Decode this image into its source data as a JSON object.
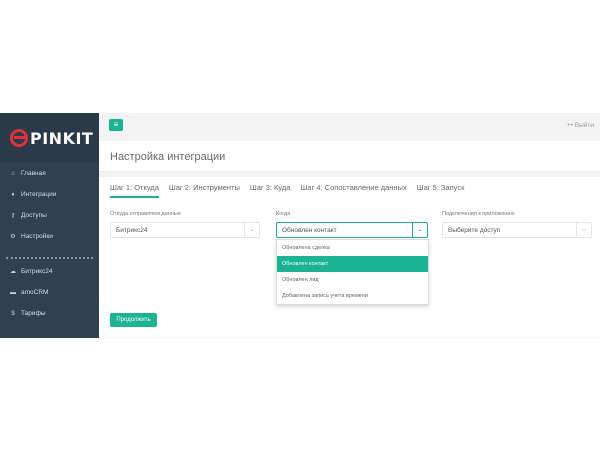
{
  "brand": {
    "logo_text": "PINKIT"
  },
  "sidebar": {
    "items": [
      {
        "icon": "home-icon",
        "glyph": "⌂",
        "label": "Главная"
      },
      {
        "icon": "integration-icon",
        "glyph": "♦",
        "label": "Интеграции"
      },
      {
        "icon": "key-icon",
        "glyph": "⚷",
        "label": "Доступы"
      },
      {
        "icon": "settings-icon",
        "glyph": "⚙",
        "label": "Настройки"
      }
    ],
    "items2": [
      {
        "icon": "cloud-icon",
        "glyph": "☁",
        "label": "Битрикс24"
      },
      {
        "icon": "drive-icon",
        "glyph": "▬",
        "label": "amoCRM"
      },
      {
        "icon": "dollar-icon",
        "glyph": "$",
        "label": "Тарифы"
      }
    ]
  },
  "topbar": {
    "menu_glyph": "≡",
    "logout_label": "Выйти",
    "logout_glyph": "↦"
  },
  "page": {
    "title": "Настройка интеграции"
  },
  "tabs": [
    {
      "label": "Шаг 1: Откуда",
      "active": true
    },
    {
      "label": "Шаг 2: Инструменты",
      "active": false
    },
    {
      "label": "Шаг 3: Куда",
      "active": false
    },
    {
      "label": "Шаг 4: Сопоставление данных",
      "active": false
    },
    {
      "label": "Шаг 5: Запуск",
      "active": false
    }
  ],
  "form": {
    "source": {
      "label": "Откуда отправляем данные",
      "value": "Битрикс24"
    },
    "when": {
      "label": "Когда",
      "value": "Обновлен контакт",
      "options": [
        "Обновлена сделка",
        "Обновлен контакт",
        "Обновлен лид",
        "Добавлена запись учета времени"
      ],
      "selected_index": 1
    },
    "connection": {
      "label": "Подключения к приложению",
      "placeholder": "Выберите доступ"
    },
    "continue_label": "Продолжить"
  },
  "colors": {
    "accent": "#1ab394",
    "sidebar_bg": "#2f4050",
    "brand_red": "#e0313e"
  }
}
